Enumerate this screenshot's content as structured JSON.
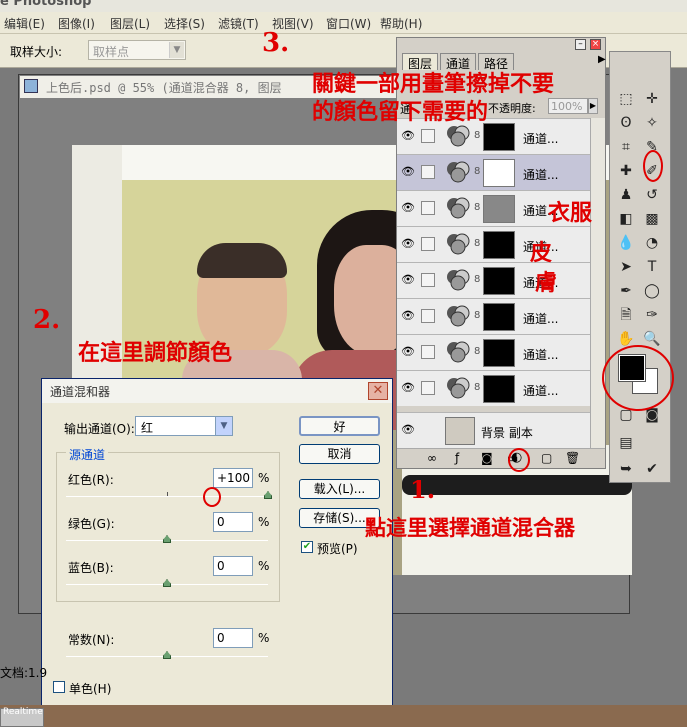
{
  "app": {
    "title": "e Photoshop",
    "menus": [
      "编辑(E)",
      "图像(I)",
      "图层(L)",
      "选择(S)",
      "滤镜(T)",
      "视图(V)",
      "窗口(W)",
      "帮助(H)"
    ]
  },
  "options_bar": {
    "sample_size_label": "取样大小:",
    "sample_size_value": "取样点"
  },
  "document": {
    "title": "上色后.psd @ 55% (通道混合器 8, 图层"
  },
  "layers_panel": {
    "tabs": [
      "图层",
      "通道",
      "路径"
    ],
    "mode_label": "通",
    "opacity_label": "不透明度:",
    "opacity_value": "100%",
    "layers": [
      {
        "name": "通道...",
        "selected": false
      },
      {
        "name": "通道...",
        "selected": true
      },
      {
        "name": "通道...",
        "selected": false
      },
      {
        "name": "通道...",
        "selected": false
      },
      {
        "name": "通道...",
        "selected": false
      },
      {
        "name": "通道...",
        "selected": false
      },
      {
        "name": "通道...",
        "selected": false
      },
      {
        "name": "通道...",
        "selected": false
      },
      {
        "name": "背景 副本",
        "selected": false
      }
    ]
  },
  "dialog": {
    "title": "通道混和器",
    "output_channel_label": "输出通道(O):",
    "output_channel_value": "红",
    "source_group_label": "源通道",
    "red_label": "红色(R):",
    "red_value": "+100",
    "green_label": "绿色(G):",
    "green_value": "0",
    "blue_label": "蓝色(B):",
    "blue_value": "0",
    "constant_label": "常数(N):",
    "constant_value": "0",
    "percent": "%",
    "ok_label": "好",
    "cancel_label": "取消",
    "load_label": "载入(L)...",
    "save_label": "存储(S)...",
    "preview_label": "预览(P)",
    "preview_checked": true,
    "monochrome_label": "单色(H)",
    "monochrome_checked": false,
    "slider_levels": {
      "red": 1.0,
      "green": 0.0,
      "blue": 0.0,
      "constant": 0.0
    }
  },
  "status": {
    "doc_text": "文档:1.9",
    "taskbar_text": "Realtime"
  },
  "annotations": {
    "step1_num": "1.",
    "step1_text": "點這里選擇通道混合器",
    "step2_num": "2.",
    "step2_text": "在這里調節顏色",
    "step3_num": "3.",
    "step3_text_line1": "關鍵一部用畫筆擦掉不要",
    "step3_text_line2": "的顏色留下需要的",
    "skin_text_1": "皮",
    "skin_text_2": "膚",
    "clothes_text": "衣服",
    "color": "#e00000"
  }
}
